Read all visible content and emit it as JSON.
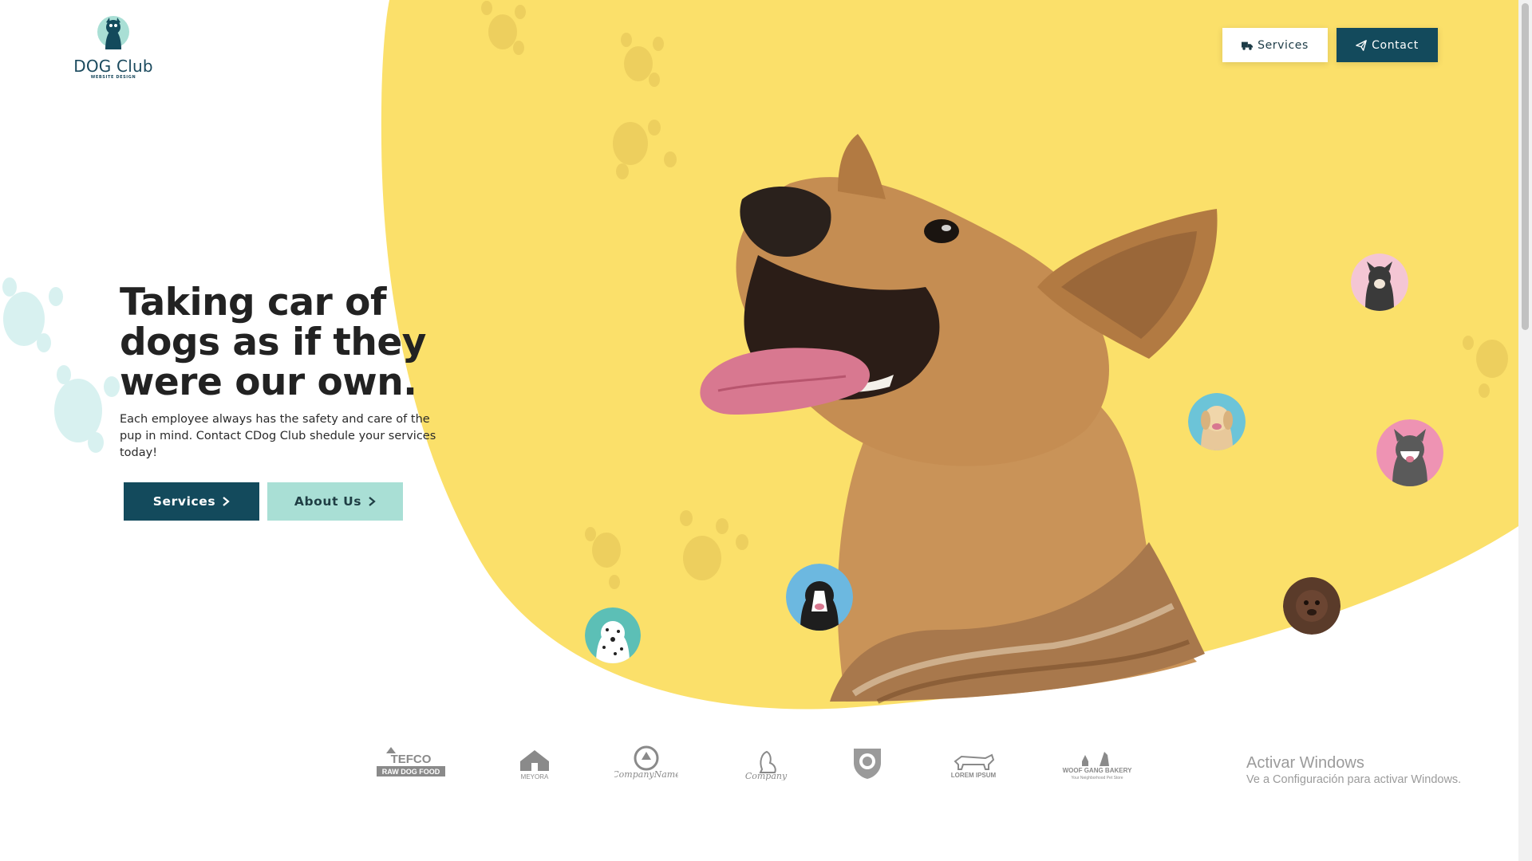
{
  "brand": {
    "name": "DOG Club",
    "tagline": "WEBSITE DESIGN",
    "colors": {
      "primary": "#134a5c",
      "accent_mint": "#a9dfd5",
      "hero_yellow": "#fbe06a"
    }
  },
  "nav": {
    "services_label": "Services",
    "services_icon": "truck-icon",
    "contact_label": "Contact",
    "contact_icon": "paper-plane-icon"
  },
  "hero": {
    "headline": "Taking car of dogs as if they were our own.",
    "subcopy": "Each employee always has the safety and care of the pup in mind. Contact CDog Club shedule your services today!",
    "primary_cta": "Services",
    "secondary_cta": "About Us",
    "cta_icon": "chevron-right-icon"
  },
  "partners": [
    {
      "name": "TEFCO",
      "sub": "RAW DOG FOOD"
    },
    {
      "name": "MEYORA",
      "sub": ""
    },
    {
      "name": "CompanyName",
      "sub": ""
    },
    {
      "name": "Company",
      "sub": ""
    },
    {
      "name": "",
      "sub": ""
    },
    {
      "name": "LOREM IPSUM",
      "sub": ""
    },
    {
      "name": "WOOF GANG BAKERY",
      "sub": "Your Neighborhood Pet Store"
    }
  ],
  "windows_watermark": {
    "title": "Activar Windows",
    "subtitle": "Ve a Configuración para activar Windows."
  }
}
